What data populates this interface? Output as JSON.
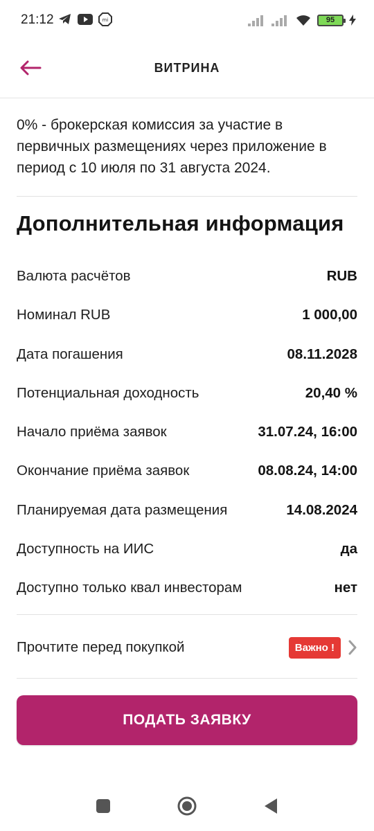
{
  "status_bar": {
    "time": "21:12",
    "battery": "95"
  },
  "header": {
    "title": "ВИТРИНА"
  },
  "promo": {
    "text": "0% - брокерская комиссия за участие в первичных размещениях через приложение в период с 10 июля по 31 августа 2024."
  },
  "info": {
    "title": "Дополнительная информация",
    "rows": [
      {
        "label": "Валюта расчётов",
        "value": "RUB"
      },
      {
        "label": "Номинал RUB",
        "value": "1 000,00"
      },
      {
        "label": "Дата погашения",
        "value": "08.11.2028"
      },
      {
        "label": "Потенциальная доходность",
        "value": "20,40 %"
      },
      {
        "label": "Начало приёма заявок",
        "value": "31.07.24, 16:00"
      },
      {
        "label": "Окончание приёма заявок",
        "value": "08.08.24, 14:00"
      },
      {
        "label": "Планируемая дата размещения",
        "value": "14.08.2024"
      },
      {
        "label": "Доступность на ИИС",
        "value": "да"
      },
      {
        "label": "Доступно только квал инвесторам",
        "value": "нет"
      }
    ]
  },
  "read_before": {
    "label": "Прочтите перед покупкой",
    "badge": "Важно !"
  },
  "submit": {
    "label": "ПОДАТЬ ЗАЯВКУ"
  },
  "colors": {
    "accent": "#b2246b",
    "badge": "#e53935"
  }
}
